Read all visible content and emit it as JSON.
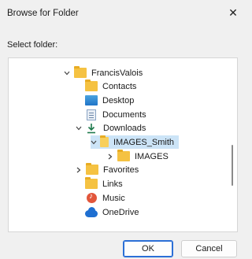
{
  "window": {
    "title": "Browse for Folder",
    "close_glyph": "✕"
  },
  "prompt": "Select folder:",
  "tree": [
    {
      "label": "FrancisValois",
      "icon": "folder-icon",
      "expand": "expanded"
    },
    {
      "label": "Contacts",
      "icon": "folder-icon",
      "expand": "none"
    },
    {
      "label": "Desktop",
      "icon": "desktop-icon",
      "expand": "none"
    },
    {
      "label": "Documents",
      "icon": "documents-icon",
      "expand": "none"
    },
    {
      "label": "Downloads",
      "icon": "download-icon",
      "expand": "expanded"
    },
    {
      "label": "IMAGES_Smith",
      "icon": "folder-open-icon",
      "expand": "expanded",
      "selected": true
    },
    {
      "label": "IMAGES",
      "icon": "folder-icon",
      "expand": "collapsed"
    },
    {
      "label": "Favorites",
      "icon": "folder-icon",
      "expand": "collapsed"
    },
    {
      "label": "Links",
      "icon": "folder-icon",
      "expand": "none"
    },
    {
      "label": "Music",
      "icon": "music-icon",
      "expand": "none"
    },
    {
      "label": "OneDrive",
      "icon": "onedrive-icon",
      "expand": "none"
    }
  ],
  "buttons": {
    "ok": "OK",
    "cancel": "Cancel"
  },
  "colors": {
    "selection": "#cce4f7",
    "accent": "#2b6fd6",
    "folder": "#f5c242"
  }
}
